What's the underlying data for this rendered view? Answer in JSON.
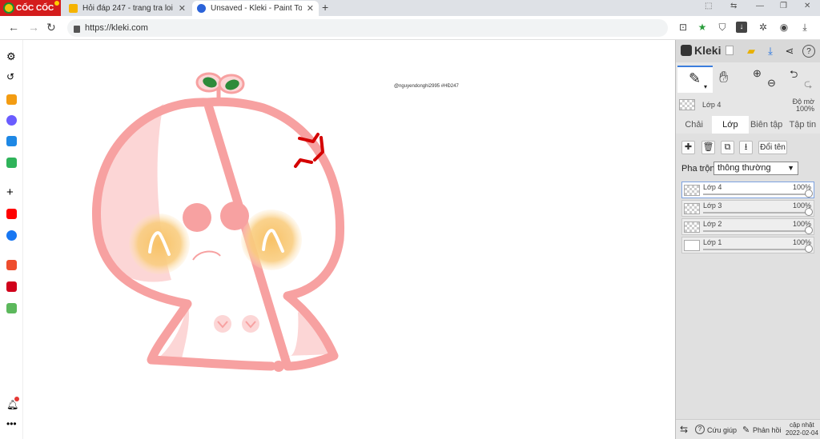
{
  "browser": {
    "brand": "CỐC CỐC",
    "tabs": [
      {
        "title": "Hỏi đáp 247 - trang tra loi",
        "icon": "hoidap-favicon"
      },
      {
        "title": "Unsaved - Kleki - Paint Tool",
        "icon": "kleki-favicon"
      }
    ],
    "url": "https://kleki.com"
  },
  "canvas": {
    "watermark": "@nguyendonghi2995 #HĐ247",
    "art": {
      "outline_color": "#f7a1a1",
      "fill_shade_color": "#fcd6d6",
      "leaf_color": "#2e8b3a",
      "cheek_color": "#f8c267",
      "anger_mark_color": "#d40000"
    }
  },
  "panel": {
    "logo": "Kleki",
    "current_layer": {
      "name": "Lớp 4",
      "opacity_label": "Độ mờ",
      "opacity_value": "100%"
    },
    "tabs": [
      "Chải",
      "Lớp",
      "Biên tập",
      "Tập tin"
    ],
    "active_tab": "Lớp",
    "rename_label": "Đổi tên",
    "blend_label": "Pha trộn",
    "blend_value": "thông thường",
    "layers": [
      {
        "name": "Lớp 4",
        "opacity": "100%",
        "selected": true
      },
      {
        "name": "Lớp 3",
        "opacity": "100%",
        "selected": false
      },
      {
        "name": "Lớp 2",
        "opacity": "100%",
        "selected": false
      },
      {
        "name": "Lớp 1",
        "opacity": "100%",
        "selected": false
      }
    ],
    "footer": {
      "help": "Cứu giúp",
      "feedback": "Phản hồi",
      "update_label": "cập nhật",
      "update_date": "2022-02-04"
    }
  }
}
